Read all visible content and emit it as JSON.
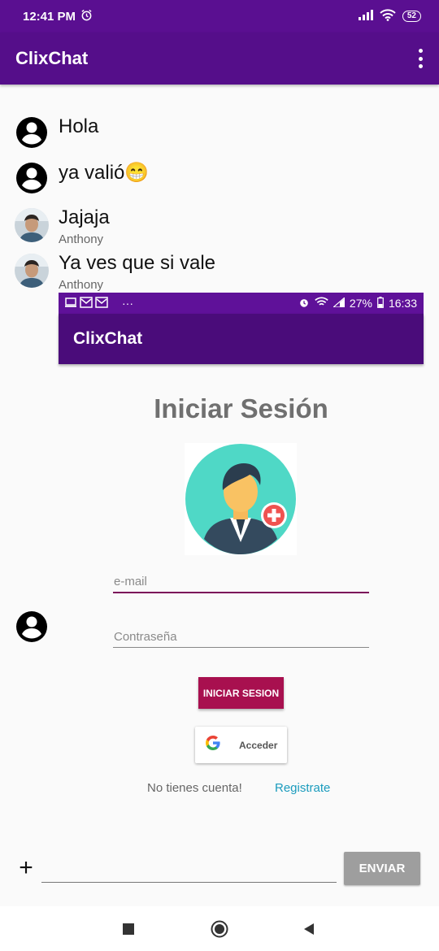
{
  "status_bar": {
    "time": "12:41 PM",
    "battery": "52"
  },
  "app_bar": {
    "title": "ClixChat"
  },
  "messages": [
    {
      "text": "Hola",
      "author": ""
    },
    {
      "text": "ya valió😁",
      "author": ""
    },
    {
      "text": "Jajaja",
      "author": "Anthony"
    },
    {
      "text": "Ya ves que si vale",
      "author": "Anthony"
    }
  ],
  "image_message": {
    "status_bar": {
      "dots": "···",
      "battery": "27%",
      "time": "16:33"
    },
    "app_title": "ClixChat",
    "login_title": "Iniciar Sesión",
    "email_placeholder": "e-mail",
    "password_placeholder": "Contraseña",
    "login_button": "INICIAR SESION",
    "google_button": "Acceder",
    "no_account_text": "No tienes cuenta!",
    "register_link": "Registrate"
  },
  "composer": {
    "plus": "+",
    "send_label": "ENVIAR"
  },
  "colors": {
    "primary": "#550e8a",
    "status": "#5a0f91",
    "accent": "#a8104f",
    "link": "#1a9bbd"
  },
  "icons": [
    "alarm-icon",
    "signal-icon",
    "wifi-icon",
    "more-vert-icon",
    "account-circle-icon",
    "stop-icon",
    "home-circle-icon",
    "back-icon"
  ]
}
